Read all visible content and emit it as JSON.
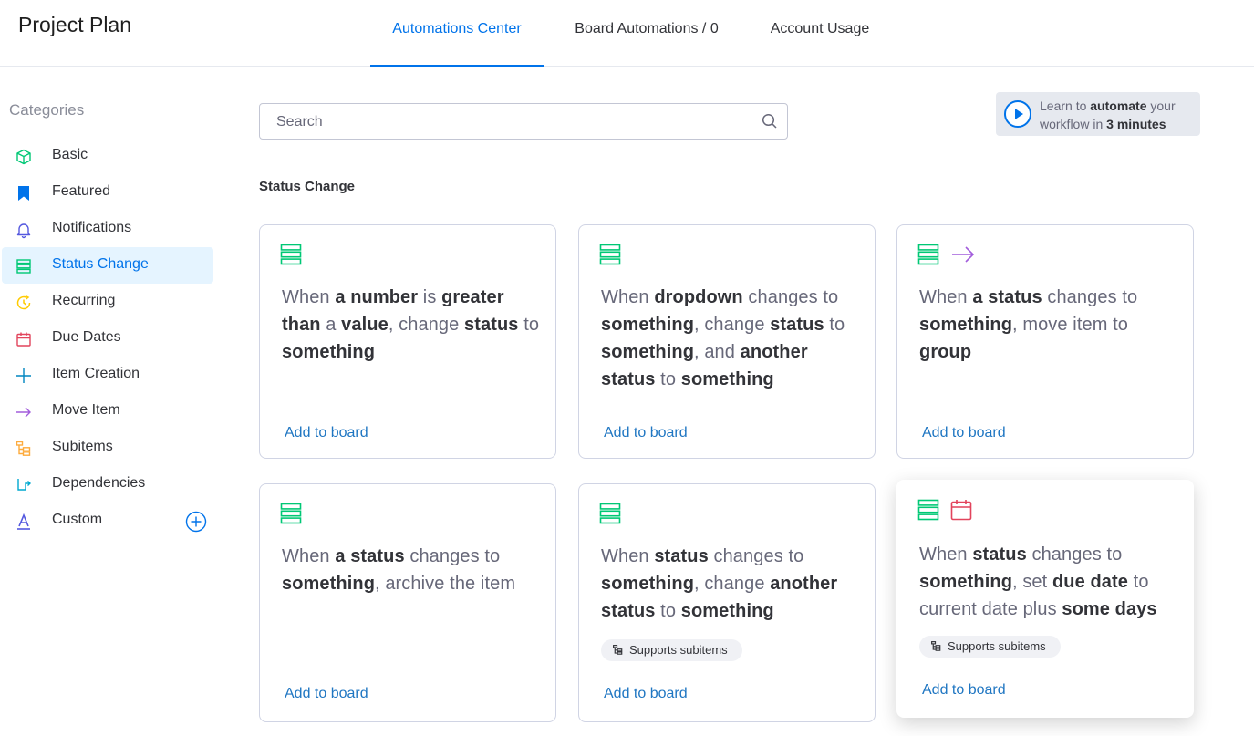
{
  "app_title": "Project Plan",
  "tabs": [
    {
      "label": "Automations Center",
      "active": true
    },
    {
      "label": "Board Automations / 0",
      "active": false
    },
    {
      "label": "Account Usage",
      "active": false
    }
  ],
  "sidebar": {
    "heading": "Categories",
    "items": [
      {
        "label": "Basic",
        "icon": "cube-icon",
        "color": "#00c875"
      },
      {
        "label": "Featured",
        "icon": "bookmark-icon",
        "color": "#0073ea"
      },
      {
        "label": "Notifications",
        "icon": "bell-icon",
        "color": "#5559df"
      },
      {
        "label": "Status Change",
        "icon": "status-icon",
        "color": "#00c875",
        "active": true
      },
      {
        "label": "Recurring",
        "icon": "clock-icon",
        "color": "#ffcb00"
      },
      {
        "label": "Due Dates",
        "icon": "calendar-icon",
        "color": "#e2445c"
      },
      {
        "label": "Item Creation",
        "icon": "plus-icon",
        "color": "#0086c0"
      },
      {
        "label": "Move Item",
        "icon": "arrow-right-icon",
        "color": "#a25ddc"
      },
      {
        "label": "Subitems",
        "icon": "subitems-icon",
        "color": "#fdab3d"
      },
      {
        "label": "Dependencies",
        "icon": "dependency-icon",
        "color": "#00a9cf"
      },
      {
        "label": "Custom",
        "icon": "letter-a-icon",
        "color": "#5559df"
      }
    ],
    "add_icon": "plus-circle-icon"
  },
  "search": {
    "placeholder": "Search",
    "value": ""
  },
  "learn": {
    "text1": "Learn to ",
    "bold1": "automate",
    "text2": " your workflow in ",
    "bold2": "3 minutes"
  },
  "section_title": "Status Change",
  "add_label": "Add to board",
  "badge_label": "Supports subitems",
  "cards": [
    {
      "parts": [
        "When ",
        "*a number",
        " is ",
        "*greater than",
        " a ",
        "*value",
        ", change ",
        "*status",
        " to ",
        "*something"
      ]
    },
    {
      "parts": [
        "When ",
        "*dropdown",
        " changes to ",
        "*something",
        ", change ",
        "*status",
        " to ",
        "*something",
        ", and ",
        "*another status",
        " to ",
        "*something"
      ]
    },
    {
      "parts": [
        "When ",
        "*a status",
        " changes to ",
        "*something",
        ", move item to ",
        "*group"
      ]
    },
    {
      "parts": [
        "When ",
        "*a status",
        " changes to ",
        "*something",
        ", archive the item"
      ]
    },
    {
      "parts": [
        "When ",
        "*status",
        " changes to ",
        "*something",
        ", change ",
        "*another status",
        " to ",
        "*something"
      ]
    },
    {
      "parts": [
        "When ",
        "*status",
        " changes to ",
        "*something",
        ", set ",
        "*due date",
        " to current date plus ",
        "*some days"
      ]
    }
  ],
  "colors": {
    "accent": "#0073ea",
    "green": "#00c875",
    "purple": "#a25ddc",
    "red": "#e2445c",
    "link": "#1f76c2"
  }
}
